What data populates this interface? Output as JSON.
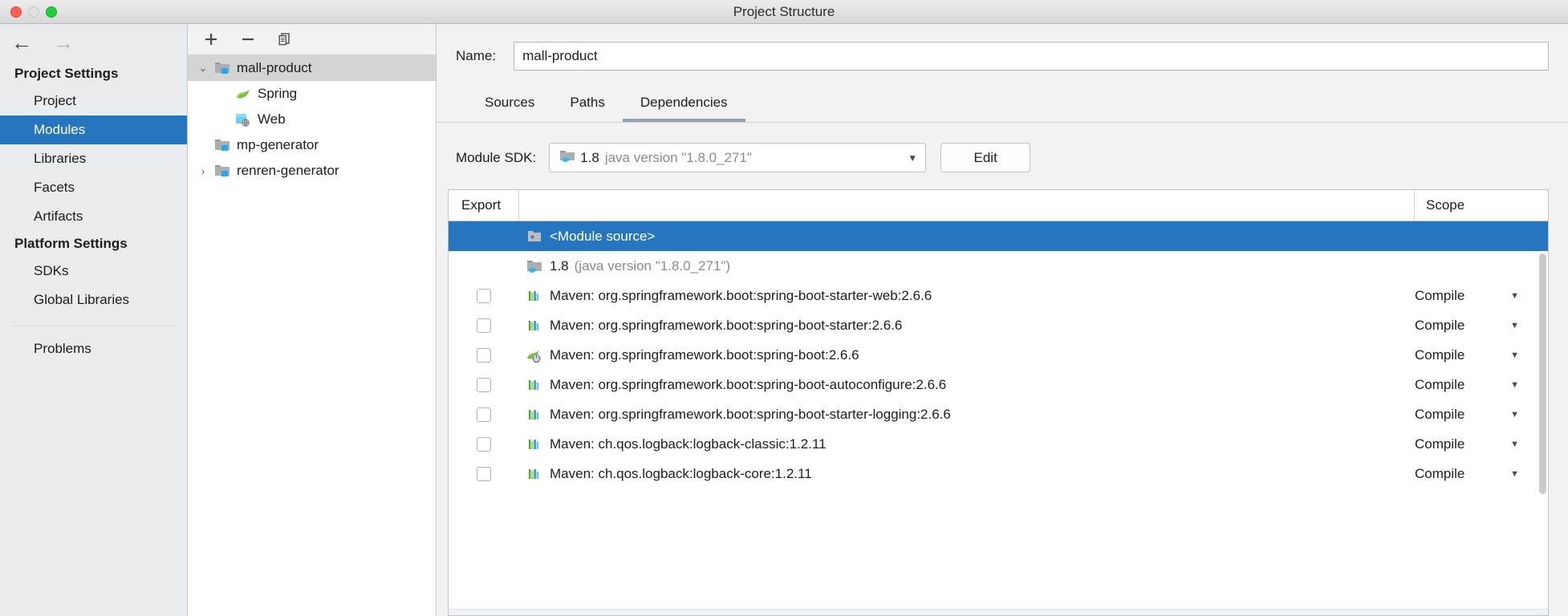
{
  "window": {
    "title": "Project Structure"
  },
  "sidebar": {
    "nav": {
      "back": "←",
      "forward": "→"
    },
    "groups": [
      {
        "label": "Project Settings",
        "items": [
          {
            "label": "Project",
            "selected": false
          },
          {
            "label": "Modules",
            "selected": true
          },
          {
            "label": "Libraries",
            "selected": false
          },
          {
            "label": "Facets",
            "selected": false
          },
          {
            "label": "Artifacts",
            "selected": false
          }
        ]
      },
      {
        "label": "Platform Settings",
        "items": [
          {
            "label": "SDKs",
            "selected": false
          },
          {
            "label": "Global Libraries",
            "selected": false
          }
        ]
      }
    ],
    "extra": [
      {
        "label": "Problems",
        "selected": false
      }
    ]
  },
  "tree": {
    "toolbar": [
      {
        "name": "add",
        "glyph": "+"
      },
      {
        "name": "remove",
        "glyph": "−"
      },
      {
        "name": "copy",
        "glyph": "❐"
      }
    ],
    "rows": [
      {
        "label": "mall-product",
        "icon": "module-folder",
        "level": 0,
        "twisty": "▾",
        "selected": true
      },
      {
        "label": "Spring",
        "icon": "spring-leaf",
        "level": 1,
        "twisty": "",
        "selected": false
      },
      {
        "label": "Web",
        "icon": "web-globe",
        "level": 1,
        "twisty": "",
        "selected": false
      },
      {
        "label": "mp-generator",
        "icon": "module-folder",
        "level": 0,
        "twisty": "",
        "selected": false
      },
      {
        "label": "renren-generator",
        "icon": "module-folder",
        "level": 0,
        "twisty": "›",
        "selected": false
      }
    ]
  },
  "detail": {
    "name_label": "Name:",
    "name_value": "mall-product",
    "tabs": [
      {
        "label": "Sources",
        "active": false
      },
      {
        "label": "Paths",
        "active": false
      },
      {
        "label": "Dependencies",
        "active": true
      }
    ],
    "sdk_label": "Module SDK:",
    "sdk_version": "1.8",
    "sdk_detail": "java version \"1.8.0_271\"",
    "edit_label": "Edit",
    "table": {
      "columns": {
        "export": "Export",
        "blank": "",
        "scope": "Scope"
      },
      "rows": [
        {
          "export": null,
          "icon": "module-source",
          "label": "<Module source>",
          "sub": "",
          "scope": "",
          "selected": true
        },
        {
          "export": null,
          "icon": "jdk-folder",
          "label": "1.8",
          "sub": "(java version \"1.8.0_271\")",
          "scope": "",
          "selected": false
        },
        {
          "export": false,
          "icon": "maven-lib",
          "label": "Maven: org.springframework.boot:spring-boot-starter-web:2.6.6",
          "sub": "",
          "scope": "Compile",
          "selected": false
        },
        {
          "export": false,
          "icon": "maven-lib",
          "label": "Maven: org.springframework.boot:spring-boot-starter:2.6.6",
          "sub": "",
          "scope": "Compile",
          "selected": false
        },
        {
          "export": false,
          "icon": "spring-boot-lib",
          "label": "Maven: org.springframework.boot:spring-boot:2.6.6",
          "sub": "",
          "scope": "Compile",
          "selected": false
        },
        {
          "export": false,
          "icon": "maven-lib",
          "label": "Maven: org.springframework.boot:spring-boot-autoconfigure:2.6.6",
          "sub": "",
          "scope": "Compile",
          "selected": false
        },
        {
          "export": false,
          "icon": "maven-lib",
          "label": "Maven: org.springframework.boot:spring-boot-starter-logging:2.6.6",
          "sub": "",
          "scope": "Compile",
          "selected": false
        },
        {
          "export": false,
          "icon": "maven-lib",
          "label": "Maven: ch.qos.logback:logback-classic:1.2.11",
          "sub": "",
          "scope": "Compile",
          "selected": false
        },
        {
          "export": false,
          "icon": "maven-lib",
          "label": "Maven: ch.qos.logback:logback-core:1.2.11",
          "sub": "",
          "scope": "Compile",
          "selected": false
        }
      ]
    }
  },
  "colors": {
    "selection_blue": "#2675bf",
    "sidebar_bg": "#e8ecef",
    "panel_bg": "#f2f2f2",
    "tab_underline": "#93a3b5"
  }
}
